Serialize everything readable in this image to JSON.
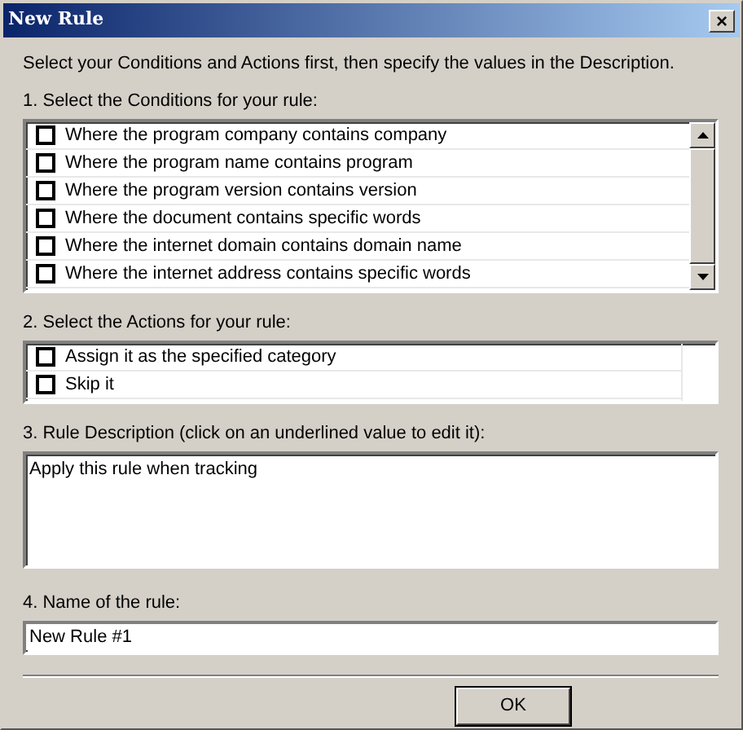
{
  "window": {
    "title": "New Rule",
    "close": "×"
  },
  "intro": "Select your Conditions and Actions first, then specify the values in the Description.",
  "conditions": {
    "label": "1. Select the Conditions for your rule:",
    "items": [
      {
        "text": "Where the program company contains company",
        "checked": false
      },
      {
        "text": "Where the program name contains program",
        "checked": false
      },
      {
        "text": "Where the program version contains version",
        "checked": false
      },
      {
        "text": "Where the document contains specific words",
        "checked": false
      },
      {
        "text": "Where the internet domain contains domain name",
        "checked": false
      },
      {
        "text": "Where the internet address contains specific words",
        "checked": false
      }
    ]
  },
  "actions": {
    "label": "2. Select the Actions for your rule:",
    "items": [
      {
        "text": "Assign it as the specified category",
        "checked": false
      },
      {
        "text": "Skip it",
        "checked": false
      }
    ]
  },
  "description": {
    "label": "3. Rule Description (click on an underlined value to edit it):",
    "text": "Apply this rule when tracking"
  },
  "name": {
    "label": "4. Name of the rule:",
    "value": "New Rule #1"
  },
  "buttons": [
    "OK"
  ]
}
